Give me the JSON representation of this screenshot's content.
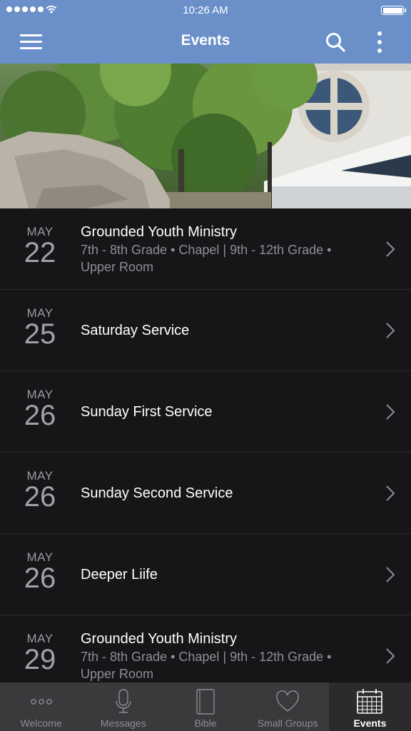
{
  "status": {
    "time": "10:26 AM"
  },
  "header": {
    "title": "Events"
  },
  "events": [
    {
      "month": "MAY",
      "day": "22",
      "title": "Grounded Youth Ministry",
      "subtitle": "7th - 8th Grade • Chapel | 9th - 12th Grade • Upper Room"
    },
    {
      "month": "MAY",
      "day": "25",
      "title": "Saturday Service"
    },
    {
      "month": "MAY",
      "day": "26",
      "title": "Sunday First Service"
    },
    {
      "month": "MAY",
      "day": "26",
      "title": "Sunday Second Service"
    },
    {
      "month": "MAY",
      "day": "26",
      "title": "Deeper Liife"
    },
    {
      "month": "MAY",
      "day": "29",
      "title": "Grounded Youth Ministry",
      "subtitle": "7th - 8th Grade • Chapel | 9th - 12th Grade • Upper Room"
    }
  ],
  "tabs": [
    {
      "label": "Welcome",
      "icon": "more-dots-icon"
    },
    {
      "label": "Messages",
      "icon": "microphone-icon"
    },
    {
      "label": "Bible",
      "icon": "book-icon"
    },
    {
      "label": "Small Groups",
      "icon": "heart-icon"
    },
    {
      "label": "Events",
      "icon": "calendar-icon",
      "active": true
    }
  ],
  "colors": {
    "header": "#6a8fc9",
    "list_background": "#161618",
    "tabbar": "#3a3a3c"
  }
}
